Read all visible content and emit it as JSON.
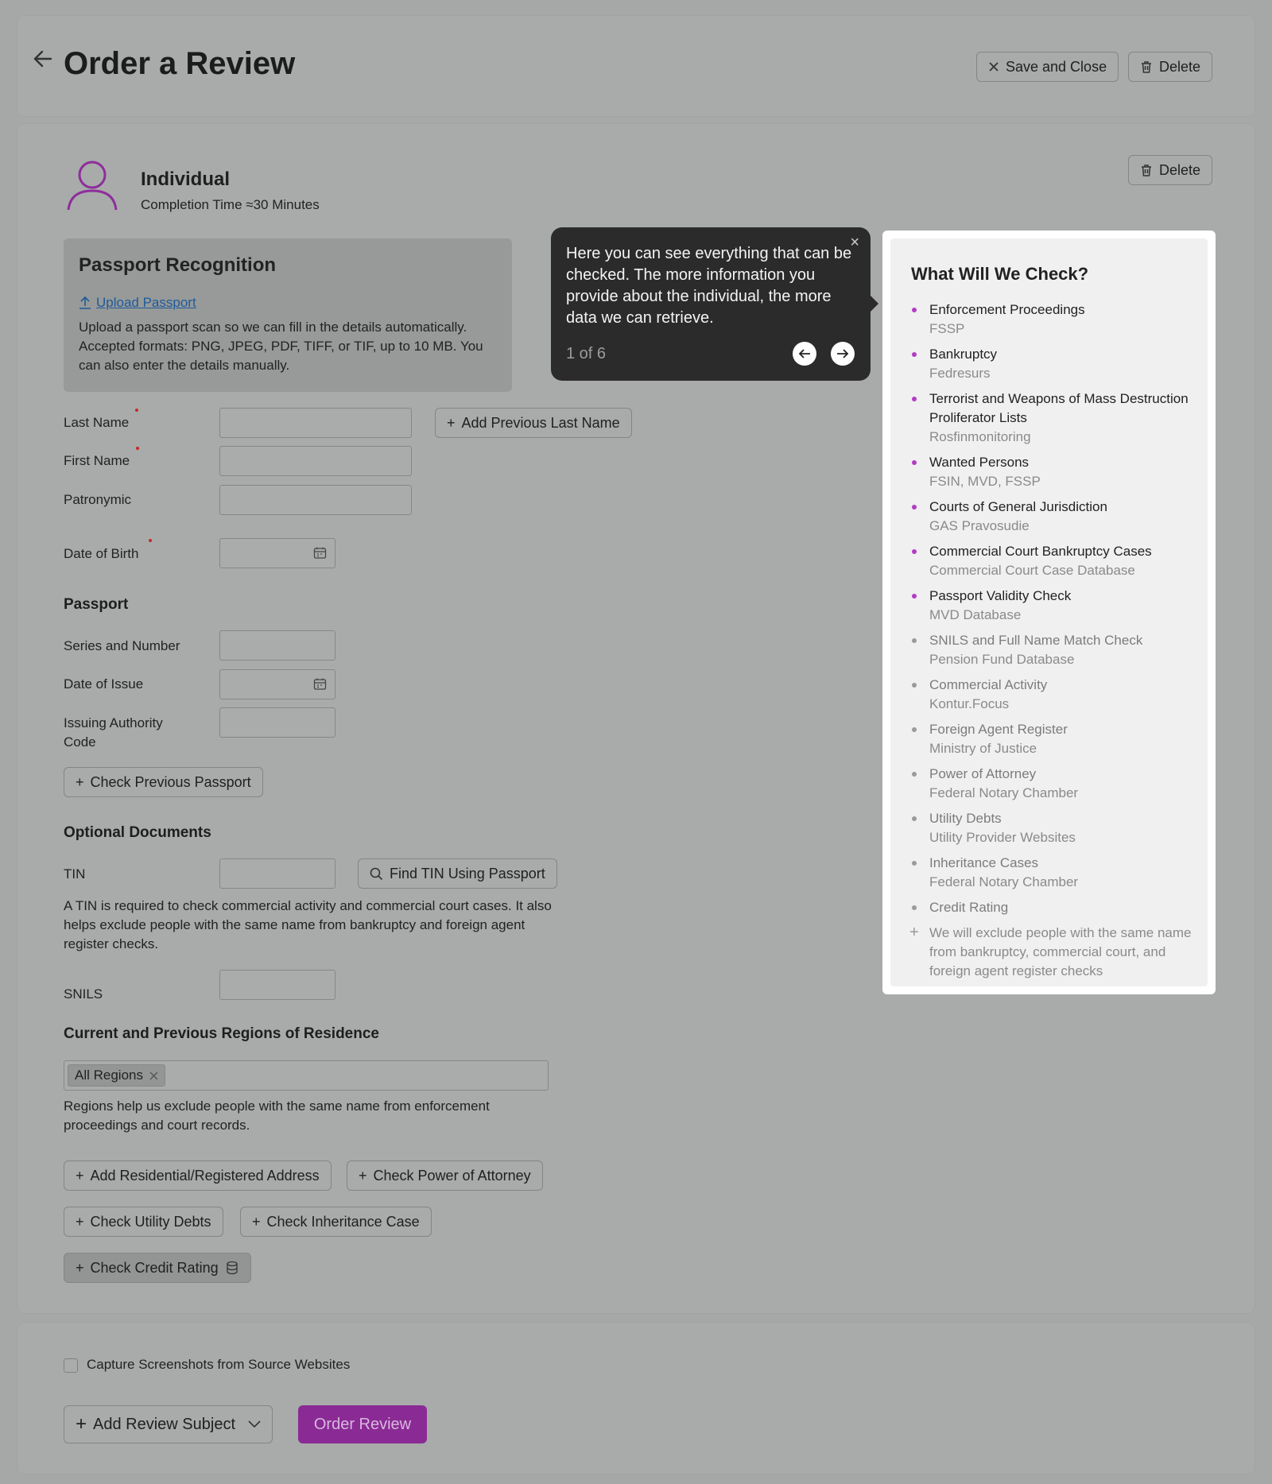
{
  "header": {
    "title": "Order a Review",
    "save_close_label": "Save and Close",
    "delete_label": "Delete"
  },
  "subject": {
    "type": "Individual",
    "completion": "Completion Time ≈30 Minutes",
    "delete_label": "Delete"
  },
  "passport_recognition": {
    "title": "Passport Recognition",
    "upload_label": "Upload Passport",
    "description": "Upload a passport scan so we can fill in the details automatically. Accepted formats: PNG, JPEG, PDF, TIFF, or TIF, up to 10 MB. You can also enter the details manually."
  },
  "fields": {
    "last_name": "Last Name",
    "first_name": "First Name",
    "patronymic": "Patronymic",
    "dob": "Date of Birth",
    "add_prev_last_name": "Add Previous Last Name"
  },
  "passport": {
    "heading": "Passport",
    "series_number": "Series and Number",
    "date_issue": "Date of Issue",
    "issuing_code_line1": "Issuing Authority",
    "issuing_code_line2": "Code",
    "check_prev": "Check Previous Passport"
  },
  "optional": {
    "heading": "Optional Documents",
    "tin": "TIN",
    "find_tin": "Find TIN Using Passport",
    "tin_help": "A TIN is required to check commercial activity and commercial court cases. It also helps exclude people with the same name from bankruptcy and foreign agent register checks.",
    "snils": "SNILS"
  },
  "regions": {
    "heading": "Current and Previous Regions of Residence",
    "chip": "All Regions",
    "help": "Regions help us exclude people with the same name from enforcement proceedings and court records."
  },
  "actions": {
    "add_address": "Add Residential/Registered Address",
    "check_poa": "Check Power of Attorney",
    "check_utility": "Check Utility Debts",
    "check_inheritance": "Check Inheritance Case",
    "check_credit": "Check Credit Rating"
  },
  "tooltip": {
    "text": "Here you can see everything that can be checked. The more information you provide about the individual, the more data we can retrieve.",
    "step": "1 of 6"
  },
  "checks": {
    "title": "What Will We Check?",
    "items": [
      {
        "name": "Enforcement Proceedings",
        "source": "FSSP",
        "active": true
      },
      {
        "name": "Bankruptcy",
        "source": "Fedresurs",
        "active": true
      },
      {
        "name": "Terrorist and Weapons of Mass Destruction Proliferator Lists",
        "source": "Rosfinmonitoring",
        "active": true
      },
      {
        "name": "Wanted Persons",
        "source": "FSIN, MVD, FSSP",
        "active": true
      },
      {
        "name": "Courts of General Jurisdiction",
        "source": "GAS Pravosudie",
        "active": true
      },
      {
        "name": "Commercial Court Bankruptcy Cases",
        "source": "Commercial Court Case Database",
        "active": true
      },
      {
        "name": "Passport Validity Check",
        "source": "MVD Database",
        "active": true
      },
      {
        "name": "SNILS and Full Name Match Check",
        "source": "Pension Fund Database",
        "active": false
      },
      {
        "name": "Commercial Activity",
        "source": "Kontur.Focus",
        "active": false
      },
      {
        "name": "Foreign Agent Register",
        "source": "Ministry of Justice",
        "active": false
      },
      {
        "name": "Power of Attorney",
        "source": "Federal Notary Chamber",
        "active": false
      },
      {
        "name": "Utility Debts",
        "source": "Utility Provider Websites",
        "active": false
      },
      {
        "name": "Inheritance Cases",
        "source": "Federal Notary Chamber",
        "active": false
      },
      {
        "name": "Credit Rating",
        "source": "",
        "active": false
      }
    ],
    "extra": "We will exclude people with the same name from bankruptcy, commercial court, and foreign agent register checks"
  },
  "footer": {
    "capture_label": "Capture Screenshots from Source Websites",
    "add_subject": "Add Review Subject",
    "order": "Order Review"
  },
  "colors": {
    "accent": "#8a2b95",
    "active_dot": "#b33bc4",
    "inactive_dot": "#9a9a9a"
  }
}
